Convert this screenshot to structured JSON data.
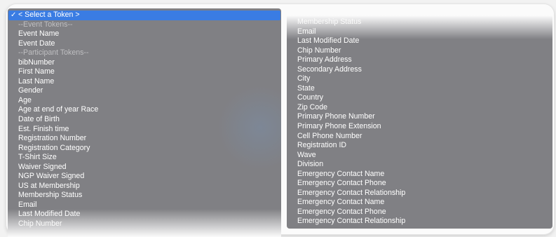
{
  "left_menu": {
    "selected": "< Select a Token >",
    "check": "✓",
    "items": [
      {
        "label": "--Event Tokens--",
        "header": true
      },
      {
        "label": "Event Name"
      },
      {
        "label": "Event Date"
      },
      {
        "label": "--Participant Tokens--",
        "header": true
      },
      {
        "label": "bibNumber"
      },
      {
        "label": "First Name"
      },
      {
        "label": "Last Name"
      },
      {
        "label": "Gender"
      },
      {
        "label": "Age"
      },
      {
        "label": "Age at end of year Race"
      },
      {
        "label": "Date of Birth"
      },
      {
        "label": "Est. Finish time"
      },
      {
        "label": "Registration Number"
      },
      {
        "label": "Registration Category"
      },
      {
        "label": "T-Shirt Size"
      },
      {
        "label": "Waiver Signed"
      },
      {
        "label": "NGP Waiver Signed"
      },
      {
        "label": "US at Membership"
      },
      {
        "label": "Membership Status"
      },
      {
        "label": "Email"
      },
      {
        "label": "Last Modified Date"
      },
      {
        "label": "Chip Number"
      }
    ]
  },
  "right_menu": {
    "items": [
      {
        "label": "Membership Status"
      },
      {
        "label": "Email"
      },
      {
        "label": "Last Modified Date"
      },
      {
        "label": "Chip Number"
      },
      {
        "label": "Primary Address"
      },
      {
        "label": "Secondary Address"
      },
      {
        "label": "City"
      },
      {
        "label": "State"
      },
      {
        "label": "Country"
      },
      {
        "label": "Zip Code"
      },
      {
        "label": "Primary Phone Number"
      },
      {
        "label": "Primary Phone Extension"
      },
      {
        "label": "Cell Phone Number"
      },
      {
        "label": "Registration ID"
      },
      {
        "label": "Wave"
      },
      {
        "label": "Division"
      },
      {
        "label": "Emergency Contact Name"
      },
      {
        "label": "Emergency Contact Phone"
      },
      {
        "label": "Emergency Contact Relationship"
      },
      {
        "label": "Emergency Contact Name"
      },
      {
        "label": "Emergency Contact Phone"
      },
      {
        "label": "Emergency Contact Relationship"
      }
    ]
  },
  "colors": {
    "menu_background": "#808084",
    "selection": "#3a7ce3",
    "item_text": "#ffffff",
    "header_text": "#bfbfc2"
  }
}
